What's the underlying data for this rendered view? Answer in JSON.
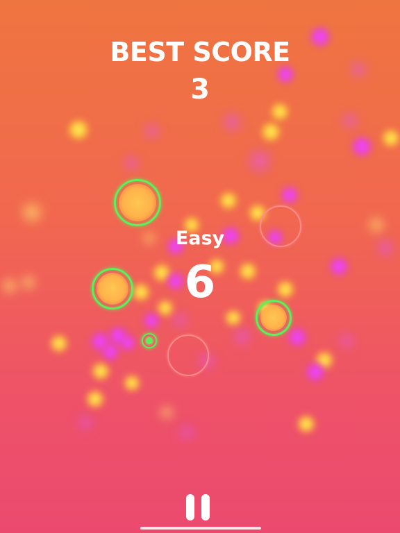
{
  "hud": {
    "best_score_label": "BEST SCORE",
    "best_score_value": "3",
    "difficulty": "Easy",
    "score": "6"
  },
  "controls": {
    "pause_icon": "pause-icon"
  },
  "colors": {
    "background_top": "#ef7540",
    "background_bottom": "#eb4a6e",
    "target_ring": "#5cf05a",
    "hazard_ring": "#ff8a8a",
    "player": "#5cf05a"
  }
}
